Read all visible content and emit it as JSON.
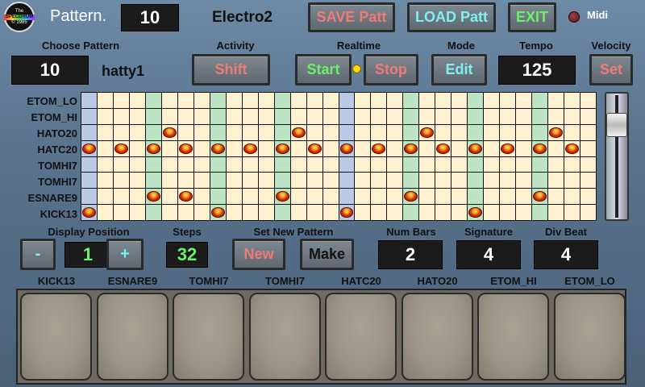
{
  "topbar": {
    "logo": {
      "line1": "The",
      "line2": "SPECDRUM",
      "line3": "© 1985"
    },
    "pattern_label": "Pattern.",
    "pattern_number": "10",
    "kit_name": "Electro2",
    "save_label": "SAVE Patt",
    "load_label": "LOAD Patt",
    "exit_label": "EXIT",
    "midi_label": "Midi"
  },
  "controls": {
    "choose_pattern": {
      "header": "Choose Pattern",
      "value": "10",
      "name": "hatty1"
    },
    "activity": {
      "header": "Activity",
      "button": "Shift"
    },
    "realtime": {
      "header": "Realtime",
      "start": "Start",
      "stop": "Stop"
    },
    "mode": {
      "header": "Mode",
      "button": "Edit"
    },
    "tempo": {
      "header": "Tempo",
      "value": "125"
    },
    "velocity": {
      "header": "Velocity",
      "button": "Set"
    }
  },
  "tracks": [
    "ETOM_LO",
    "ETOM_HI",
    "HATO20",
    "HATC20",
    "TOMHI7",
    "TOMHI7",
    "ESNARE9",
    "KICK13"
  ],
  "grid": {
    "steps": 32,
    "column_colors": {
      "blue": [
        0,
        16
      ],
      "green": [
        4,
        8,
        12,
        20,
        24,
        28
      ]
    },
    "hits": [
      [],
      [],
      [
        5,
        13,
        21,
        29
      ],
      [
        0,
        2,
        4,
        6,
        8,
        10,
        12,
        14,
        16,
        18,
        20,
        22,
        24,
        26,
        28,
        30
      ],
      [],
      [],
      [
        4,
        6,
        12,
        20,
        28
      ],
      [
        0,
        8,
        16,
        24
      ]
    ]
  },
  "bottom_controls": {
    "display_position": {
      "header": "Display Position",
      "minus": "-",
      "value": "1",
      "plus": "+"
    },
    "steps": {
      "header": "Steps",
      "value": "32"
    },
    "set_new_pattern": {
      "header": "Set New Pattern",
      "new": "New",
      "make": "Make"
    },
    "num_bars": {
      "header": "Num Bars",
      "value": "2"
    },
    "signature": {
      "header": "Signature",
      "value": "4"
    },
    "div_beat": {
      "header": "Div Beat",
      "value": "4"
    }
  },
  "pads": [
    "KICK13",
    "ESNARE9",
    "TOMHI7",
    "TOMHI7",
    "HATC20",
    "HATO20",
    "ETOM_HI",
    "ETOM_LO"
  ],
  "colors": {
    "save_text": "#f07a7a",
    "load_text": "#7ef0f0",
    "exit_text": "#6cf06c",
    "shift_text": "#f07a7a",
    "start_text": "#6cf06c",
    "stop_text": "#f07a7a",
    "edit_text": "#7ef0f0",
    "set_text": "#f07a7a",
    "indicator": "#ffd700"
  }
}
